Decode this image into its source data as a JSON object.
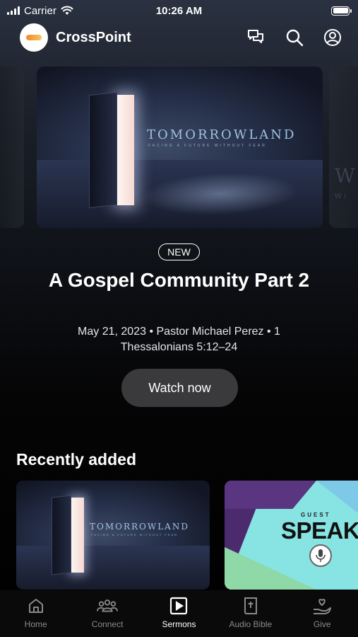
{
  "status_bar": {
    "carrier": "Carrier",
    "time": "10:26 AM"
  },
  "header": {
    "app_name": "CrossPoint",
    "icons": [
      "chat-icon",
      "search-icon",
      "profile-icon"
    ]
  },
  "hero": {
    "artwork": {
      "title": "TOMORROWLAND",
      "subtitle": "FACING A FUTURE WITHOUT FEAR"
    },
    "badge": "NEW",
    "title": "A Gospel Community Part 2",
    "meta": "May 21, 2023 • Pastor Michael Perez • 1 Thessalonians 5:12–24",
    "watch_label": "Watch now"
  },
  "recently_added": {
    "title": "Recently added",
    "items": [
      {
        "artwork_title": "TOMORROWLAND",
        "artwork_subtitle": "FACING A FUTURE WITHOUT FEAR"
      },
      {
        "artwork_small": "GUEST",
        "artwork_title": "SPEAKER"
      }
    ]
  },
  "tab_bar": {
    "tabs": [
      {
        "label": "Home",
        "icon": "home-icon",
        "active": false
      },
      {
        "label": "Connect",
        "icon": "people-icon",
        "active": false
      },
      {
        "label": "Sermons",
        "icon": "play-icon",
        "active": true
      },
      {
        "label": "Audio Bible",
        "icon": "bible-icon",
        "active": false
      },
      {
        "label": "Give",
        "icon": "give-icon",
        "active": false
      }
    ]
  },
  "colors": {
    "accent_active": "#ffffff",
    "tab_inactive": "#8a8a8e",
    "button_bg": "#3a3a3c"
  }
}
